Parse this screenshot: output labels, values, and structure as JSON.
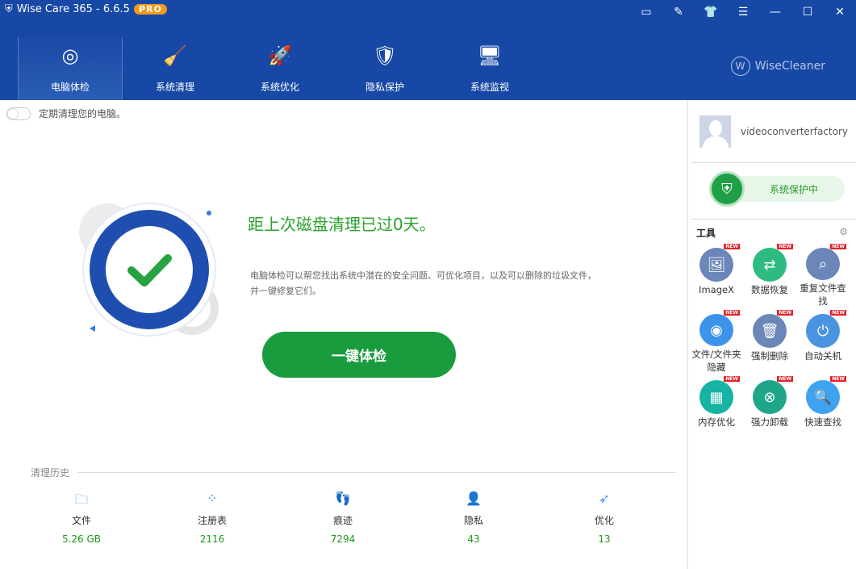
{
  "app": {
    "title": "Wise Care 365 - 6.6.5",
    "badge": "PRO",
    "brand": "WiseCleaner"
  },
  "nav": [
    {
      "label": "电脑体检",
      "icon": "radar-icon"
    },
    {
      "label": "系统清理",
      "icon": "broom-icon"
    },
    {
      "label": "系统优化",
      "icon": "rocket-icon"
    },
    {
      "label": "隐私保护",
      "icon": "shield-lock-icon"
    },
    {
      "label": "系统监视",
      "icon": "monitor-icon"
    }
  ],
  "main": {
    "toggle_label": "定期清理您的电脑。",
    "headline": "距上次磁盘清理已过0天。",
    "description": "电脑体检可以帮您找出系统中潜在的安全问题、可优化项目，以及可以删除的垃圾文件，并一键修复它们。",
    "scan_button": "一键体检",
    "history_title": "清理历史",
    "history": [
      {
        "label": "文件",
        "value": "5.26 GB",
        "icon": "folder-icon"
      },
      {
        "label": "注册表",
        "value": "2116",
        "icon": "registry-icon"
      },
      {
        "label": "痕迹",
        "value": "7294",
        "icon": "footprint-icon"
      },
      {
        "label": "隐私",
        "value": "43",
        "icon": "privacy-icon"
      },
      {
        "label": "优化",
        "value": "13",
        "icon": "rocket-icon"
      }
    ]
  },
  "side": {
    "username": "videoconverterfactory",
    "protection": "系统保护中",
    "tools_title": "工具",
    "new_badge": "NEW",
    "tools": [
      {
        "label": "ImageX",
        "color": "#6b86b8",
        "glyph": "🖼"
      },
      {
        "label": "数据恢复",
        "color": "#2dbb7f",
        "glyph": "⇄"
      },
      {
        "label": "重复文件查找",
        "color": "#6b86b8",
        "glyph": "⌕"
      },
      {
        "label": "文件/文件夹隐藏",
        "color": "#3d93ea",
        "glyph": "◉"
      },
      {
        "label": "强制删除",
        "color": "#6b86b8",
        "glyph": "🗑"
      },
      {
        "label": "自动关机",
        "color": "#4a93e0",
        "glyph": "⏻"
      },
      {
        "label": "内存优化",
        "color": "#17b3a3",
        "glyph": "▦"
      },
      {
        "label": "强力卸载",
        "color": "#1fa689",
        "glyph": "⊗"
      },
      {
        "label": "快速查找",
        "color": "#3da2f0",
        "glyph": "🔍"
      }
    ]
  }
}
